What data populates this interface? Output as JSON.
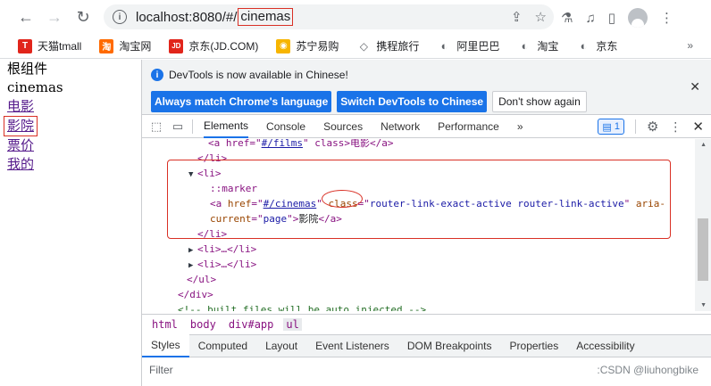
{
  "toolbar": {
    "url_host": "localhost:8080/#/",
    "url_path": "cinemas"
  },
  "bookmarks": [
    {
      "label": "天猫tmall",
      "icon_text": "T",
      "color": "#e1251b"
    },
    {
      "label": "淘宝网",
      "icon_text": "淘",
      "color": "#ff6a00"
    },
    {
      "label": "京东(JD.COM)",
      "icon_text": "JD",
      "color": "#e1251b"
    },
    {
      "label": "苏宁易购",
      "icon_text": "◉",
      "color": "#f7b500"
    },
    {
      "label": "携程旅行",
      "icon_text": "◇",
      "color": "#5f6368"
    },
    {
      "label": "阿里巴巴",
      "icon_text": "◐",
      "color": "#5f6368"
    },
    {
      "label": "淘宝",
      "icon_text": "◐",
      "color": "#5f6368"
    },
    {
      "label": "京东",
      "icon_text": "◐",
      "color": "#5f6368"
    }
  ],
  "page": {
    "line1": "根组件",
    "line2": "cinemas",
    "links": [
      "电影",
      "影院",
      "票价",
      "我的"
    ]
  },
  "devtools": {
    "info_message": "DevTools is now available in Chinese!",
    "btn_match": "Always match Chrome's language",
    "btn_switch": "Switch DevTools to Chinese",
    "btn_dont_show": "Don't show again",
    "tabs": [
      "Elements",
      "Console",
      "Sources",
      "Network",
      "Performance"
    ],
    "more_tabs": "»",
    "issues_count": "1",
    "code": {
      "row0_pre": "<a href=\"",
      "row0_href": "#/films",
      "row0_post": "\" class>电影</a>",
      "row1": "</li>",
      "row2": "<li>",
      "row3": "::marker",
      "row4_tag_open": "<a ",
      "row4_attr_href": "href",
      "row4_href": "#/cinemas",
      "row4_attr_class": "class",
      "row4_class": "router-link-exact-active router-link-active",
      "row4_attr_aria": "aria-",
      "row5_attr": "current",
      "row5_val": "page",
      "row5_txt": "影院",
      "row5_close": "</a>",
      "row6": "</li>",
      "row7": "<li>…</li>",
      "row8": "<li>…</li>",
      "row9": "</ul>",
      "row10": "</div>",
      "row11": "<!-- built files will be auto injected -->"
    },
    "breadcrumbs": [
      "html",
      "body",
      "div#app",
      "ul"
    ],
    "bottom_tabs": [
      "Styles",
      "Computed",
      "Layout",
      "Event Listeners",
      "DOM Breakpoints",
      "Properties",
      "Accessibility"
    ],
    "filter_placeholder": "Filter",
    "watermark": ":CSDN @liuhongbike"
  }
}
